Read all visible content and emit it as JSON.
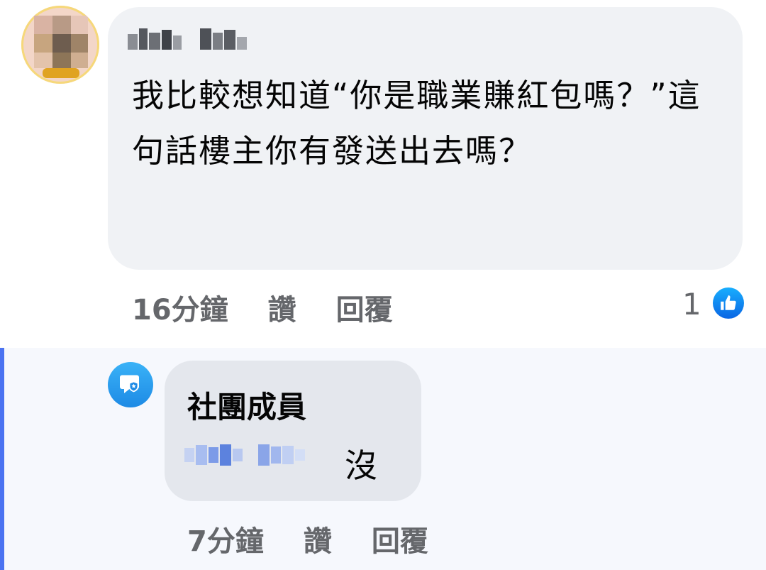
{
  "comment": {
    "text": "我比較想知道“你是職業賺紅包嗎？”這句話樓主你有發送出去嗎？",
    "meta": {
      "time": "16分鐘",
      "like": "讚",
      "reply": "回覆"
    },
    "reactions": {
      "count": "1",
      "icon": "thumbs-up-icon",
      "color": "#1877f2"
    }
  },
  "reply": {
    "author": "社團成員",
    "text": "沒",
    "meta": {
      "time": "7分鐘",
      "like": "讚",
      "reply": "回覆"
    },
    "accent_color": "#4b73f1"
  }
}
